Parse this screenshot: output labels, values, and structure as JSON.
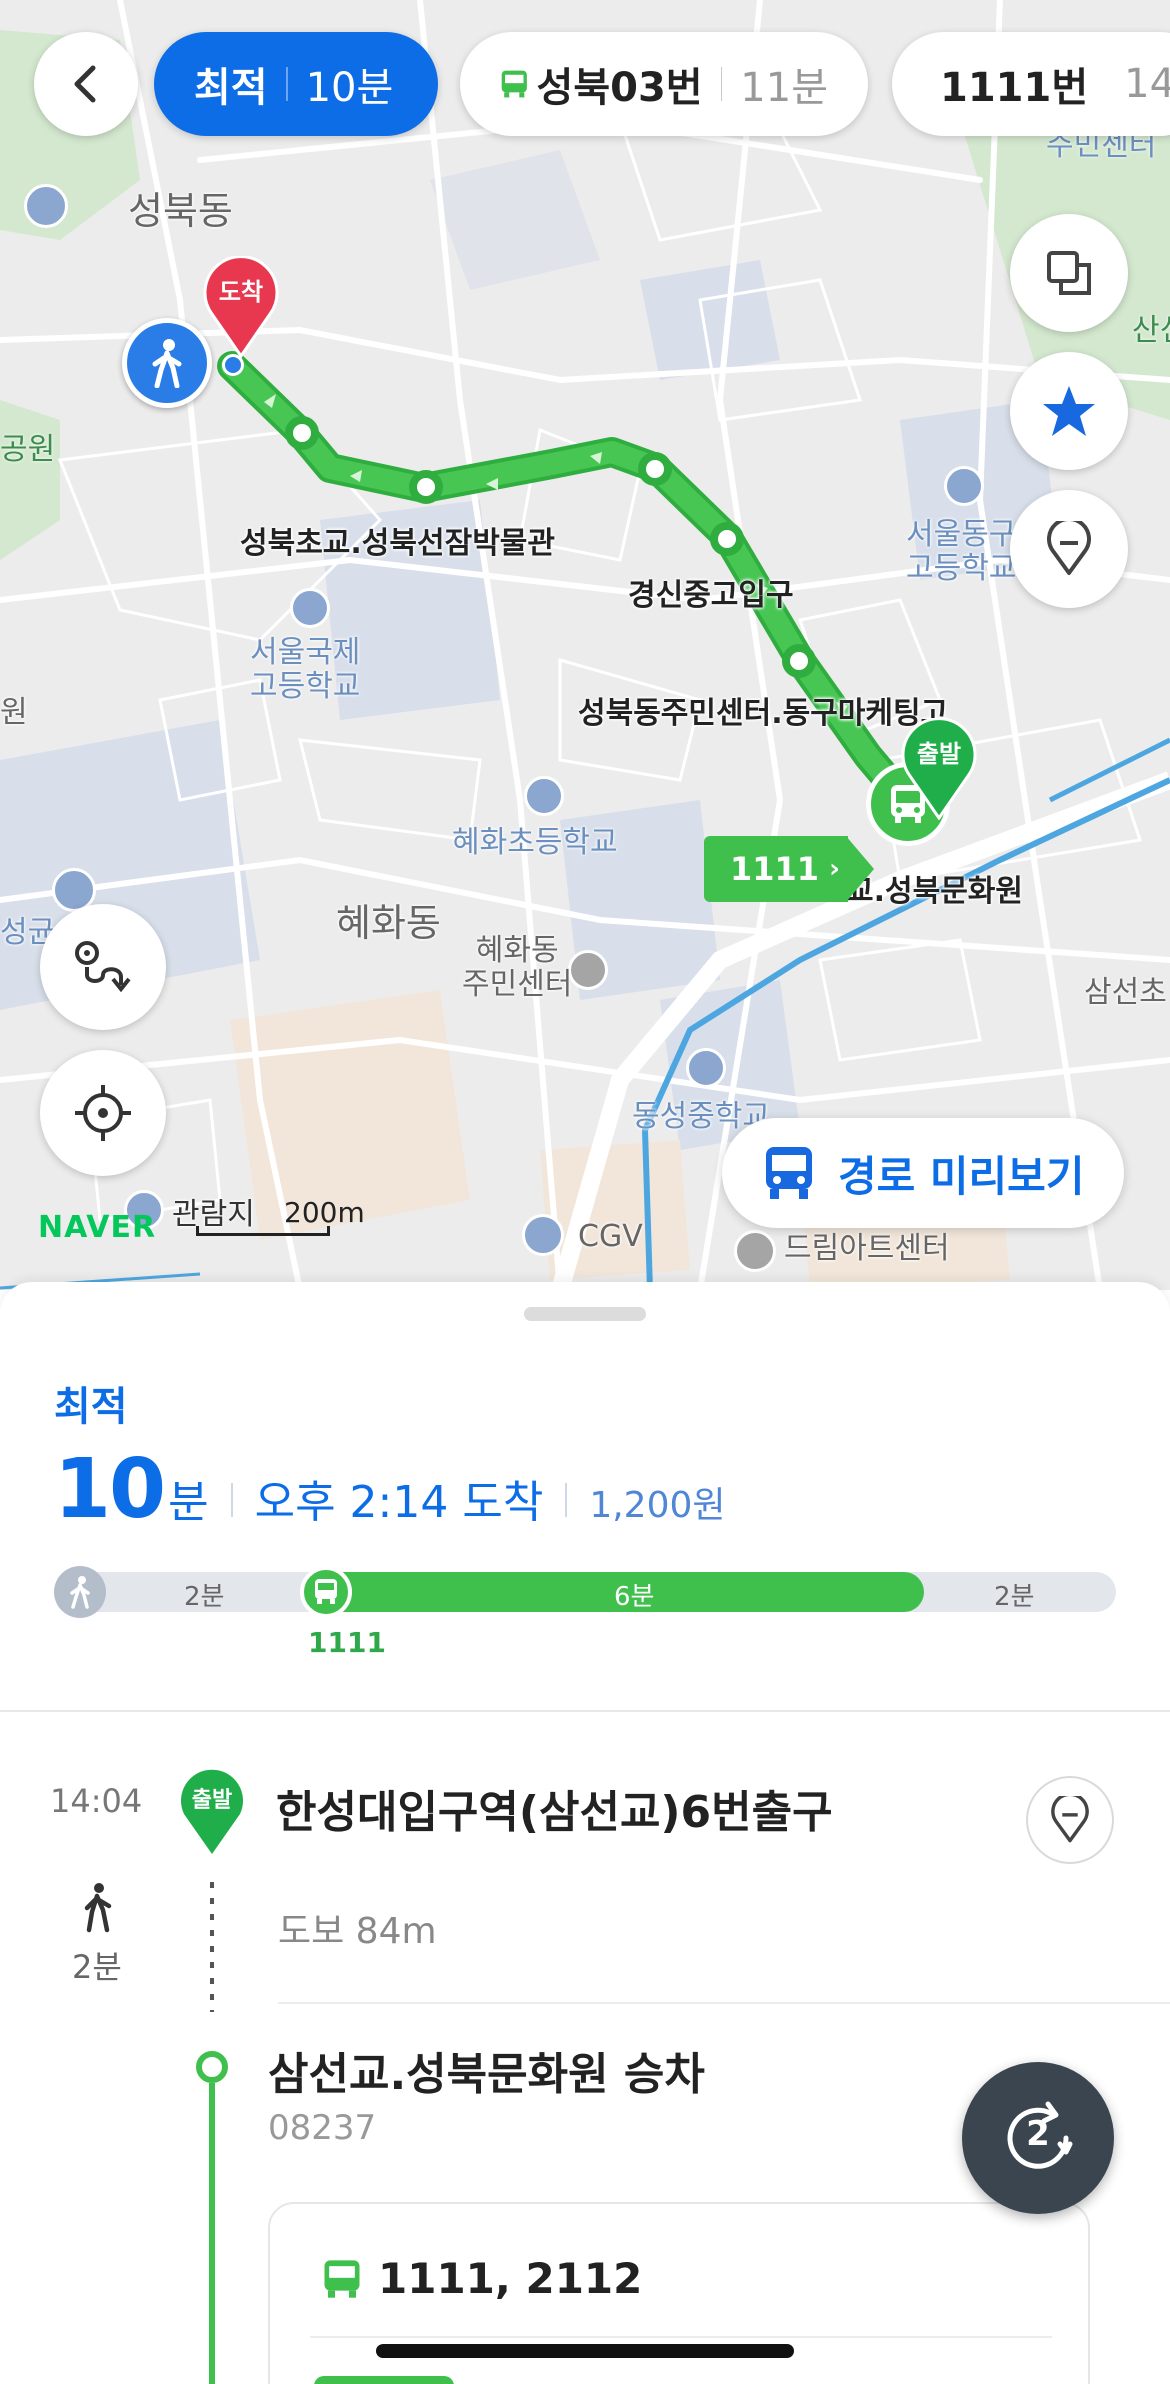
{
  "route_tabs": [
    {
      "label": "최적",
      "time": "10분",
      "active": true
    },
    {
      "label": "성북03번",
      "time": "11분",
      "active": false
    },
    {
      "label": "1111번",
      "time": "14",
      "active": false
    }
  ],
  "map": {
    "area_labels": {
      "seongbuk": "성북동",
      "hyehwa": "혜화동",
      "park_left": "공원",
      "sinhan_right": "산신한",
      "samseon_right": "삼선초",
      "left_edge_1": "원",
      "left_edge_2": "성균",
      "top_right_partial": "주민센터"
    },
    "stops": {
      "stop1": "성북초교.성북선잠박물관",
      "stop2": "경신중고입구",
      "stop3": "성북동주민센터.동구마케팅고",
      "stop4": "교.성북문화원"
    },
    "pois": {
      "seoul_intl_1": "서울국제",
      "seoul_intl_2": "고등학교",
      "hyehwa_elem": "혜화초등학교",
      "hyehwa_center_1": "혜화동",
      "hyehwa_center_2": "주민센터",
      "seouldong_1": "서울동구",
      "seouldong_2": "고등학교",
      "dongseong": "동성중학교",
      "cgv": "CGV",
      "dream": "드림아트센터",
      "gwanramji": "관람지"
    },
    "arrive_pin": "도착",
    "depart_pin": "출발",
    "bus_tag": "1111",
    "preview_button": "경로 미리보기",
    "brand": "NAVER",
    "scale": "200m",
    "colors": {
      "route": "#3fbf4c",
      "accent": "#0d6de6",
      "river": "#4ea6e0"
    }
  },
  "summary": {
    "label": "최적",
    "minutes": "10",
    "minutes_unit": "분",
    "arrival": "오후 2:14 도착",
    "fare": "1,200원",
    "timeline": {
      "walk1": "2분",
      "bus": "6분",
      "walk2": "2분",
      "bus_number": "1111"
    }
  },
  "steps": {
    "start": {
      "time": "14:04",
      "pin": "출발",
      "title": "한성대입구역(삼선교)6번출구"
    },
    "walk": {
      "minutes": "2분",
      "distance": "도보 84m"
    },
    "board": {
      "title": "삼선교.성북문화원 승차",
      "code": "08237"
    },
    "bus_card": {
      "numbers": "1111, 2112"
    }
  },
  "fab": {
    "count": "2"
  }
}
